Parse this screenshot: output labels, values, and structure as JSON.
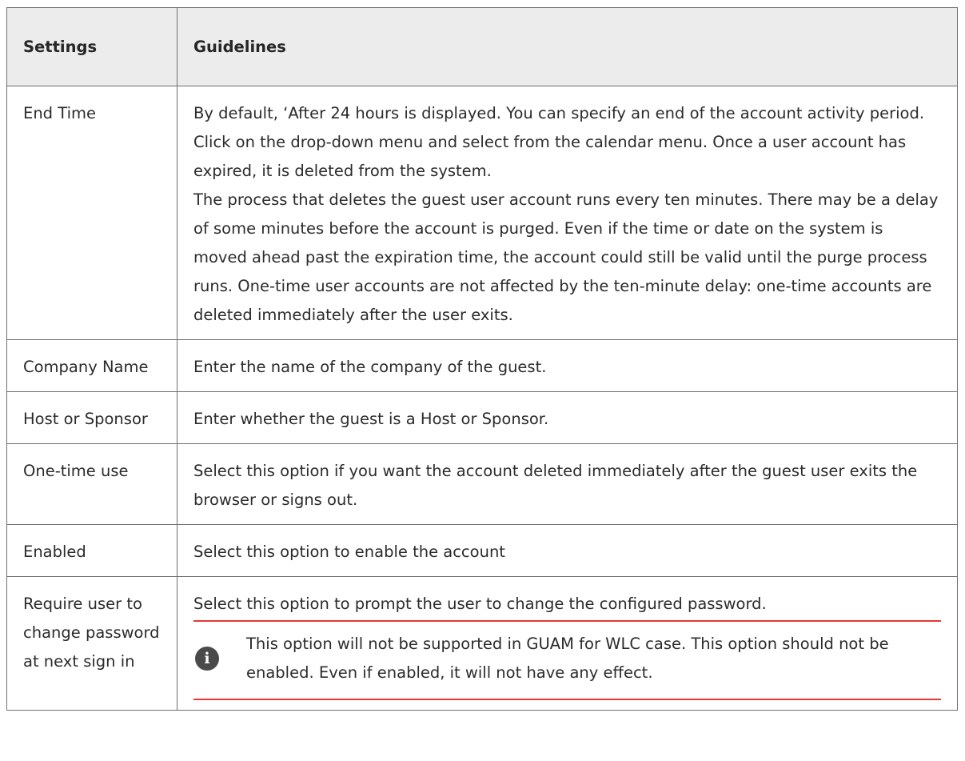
{
  "table": {
    "headers": {
      "settings": "Settings",
      "guidelines": "Guidelines"
    },
    "rows": [
      {
        "setting": "End Time",
        "guideline_p1": "By default, ‘After 24 hours is displayed. You can specify an end of the account activity period. Click on the drop-down menu and select from the calendar menu. Once a user account has expired, it is deleted from the system.",
        "guideline_p2": "The process that deletes the guest user account runs every ten minutes. There may be a delay of some minutes before the account is purged. Even if the time or date on the system is moved ahead past the expiration time, the account could still be valid until the purge process runs. One-time user accounts are not affected by the ten-minute delay: one-time accounts are deleted immediately after the user exits."
      },
      {
        "setting": "Company Name",
        "guideline": "Enter the name of the company of the guest."
      },
      {
        "setting": "Host or Sponsor",
        "guideline": "Enter whether the guest is a Host or Sponsor."
      },
      {
        "setting": "One-time use",
        "guideline": "Select this option if you want the account deleted immediately after the guest user exits the browser or signs out."
      },
      {
        "setting": "Enabled",
        "guideline": "Select this option to enable the account"
      },
      {
        "setting": "Require user to change password at next sign in",
        "guideline": "Select this option to prompt the user to change the configured password.",
        "note_icon": "info-icon",
        "note": "This option will not be supported in GUAM for WLC case. This option should not be enabled. Even if enabled, it will not have any effect."
      }
    ]
  },
  "colors": {
    "header_bg": "#ececec",
    "border": "#6f6f6f",
    "highlight_underline": "#e53935",
    "info_icon_bg": "#4a4a4a"
  }
}
